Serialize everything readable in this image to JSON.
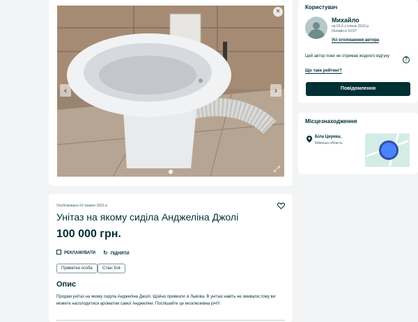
{
  "gallery": {
    "arrow_left": "‹",
    "arrow_right": "›",
    "expand_icon": "⤢",
    "close_icon": "×"
  },
  "user": {
    "section_title": "Користувач",
    "name": "Михайло",
    "since": "на OLX з січень 2016 р.",
    "online": "Онлайн в 10:07",
    "all_ads_link": "Усі оголошення автора",
    "rating_note": "Цей автор поки не отримав жодного відгуку",
    "help_icon": "?",
    "rating_link": "Що таке рейтинг?",
    "message_button": "Повідомлення"
  },
  "location": {
    "section_title": "Місцезнаходження",
    "city": "Біла Церква,",
    "region": "Київська область"
  },
  "ad": {
    "published": "Опубліковано 03 травня 2022 р.",
    "title": "Унітаз на якому сиділа Анджеліна Джолі",
    "price": "100 000 грн.",
    "promote_label": "РЕКЛАМУВАТИ",
    "raise_label": "ПІДНЯТИ",
    "tag_seller": "Приватна особа",
    "tag_condition": "Стан: Б/в",
    "description_title": "Опис",
    "description": "Продам унітаз на якому сиділа Анджеліна Джолі. Щойно привезли зі Львова. В унітазі навіть не змивали,тому ви можете насолодитися ароматом самої Анджеліни. Поспішайте це ексклюзивна річ!!!"
  },
  "colors": {
    "accent": "#002f34",
    "background": "#f2f4f5",
    "map_marker": "#3a77ff"
  }
}
